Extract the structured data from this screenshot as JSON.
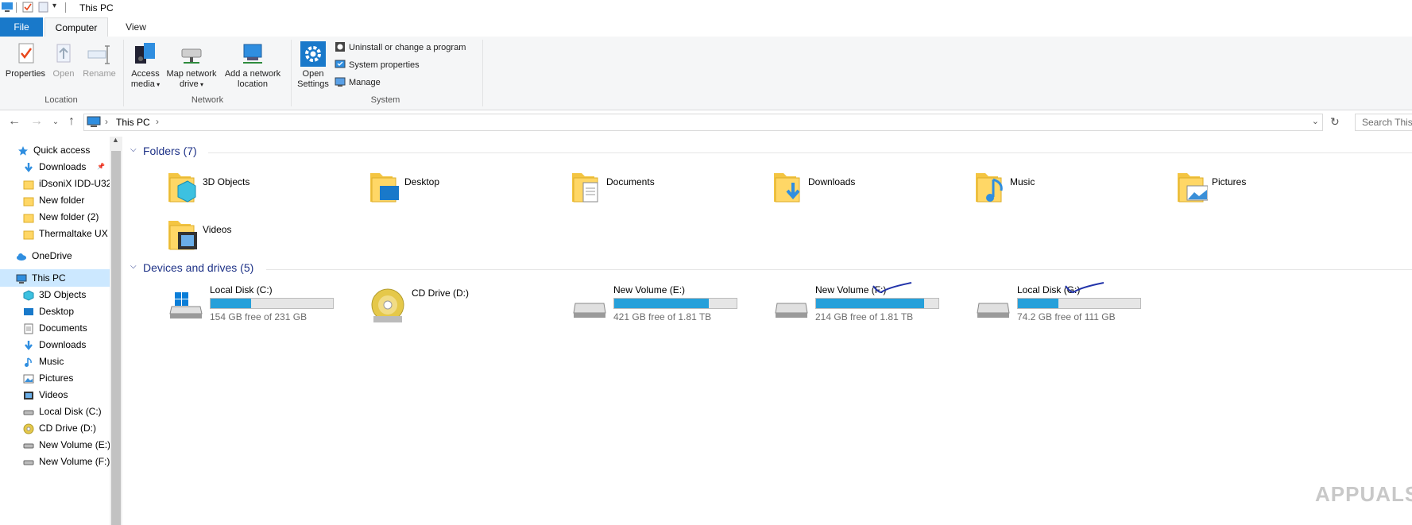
{
  "window": {
    "title": "This PC"
  },
  "ribbon_tabs": {
    "file": "File",
    "computer": "Computer",
    "view": "View"
  },
  "ribbon": {
    "location": {
      "label": "Location",
      "properties": "Properties",
      "open": "Open",
      "rename": "Rename"
    },
    "network": {
      "label": "Network",
      "access_media": "Access media",
      "map_drive_1": "Map network",
      "map_drive_2": "drive",
      "add_location_1": "Add a network",
      "add_location_2": "location"
    },
    "system": {
      "label": "System",
      "open_settings_1": "Open",
      "open_settings_2": "Settings",
      "uninstall": "Uninstall or change a program",
      "sys_props": "System properties",
      "manage": "Manage"
    }
  },
  "address": {
    "crumb": "This PC",
    "search_placeholder": "Search This"
  },
  "nav": [
    {
      "label": "Quick access",
      "icon": "star-icon"
    },
    {
      "label": "Downloads",
      "icon": "download-icon"
    },
    {
      "label": "iDsoniX IDD-U32",
      "icon": "folder-icon"
    },
    {
      "label": "New folder",
      "icon": "folder-icon"
    },
    {
      "label": "New folder (2)",
      "icon": "folder-icon"
    },
    {
      "label": "Thermaltake UX",
      "icon": "folder-icon"
    },
    {
      "label": "OneDrive",
      "icon": "cloud-icon"
    },
    {
      "label": "This PC",
      "icon": "computer-icon"
    },
    {
      "label": "3D Objects",
      "icon": "cube-icon"
    },
    {
      "label": "Desktop",
      "icon": "desktop-icon"
    },
    {
      "label": "Documents",
      "icon": "document-icon"
    },
    {
      "label": "Downloads",
      "icon": "download-icon"
    },
    {
      "label": "Music",
      "icon": "music-icon"
    },
    {
      "label": "Pictures",
      "icon": "pictures-icon"
    },
    {
      "label": "Videos",
      "icon": "video-icon"
    },
    {
      "label": "Local Disk (C:)",
      "icon": "drive-icon"
    },
    {
      "label": "CD Drive (D:)",
      "icon": "cd-icon"
    },
    {
      "label": "New Volume (E:)",
      "icon": "drive-icon"
    },
    {
      "label": "New Volume (F:)",
      "icon": "drive-icon"
    }
  ],
  "folders_section": {
    "title": "Folders (7)"
  },
  "folders": [
    {
      "name": "3D Objects"
    },
    {
      "name": "Desktop"
    },
    {
      "name": "Documents"
    },
    {
      "name": "Downloads"
    },
    {
      "name": "Music"
    },
    {
      "name": "Pictures"
    },
    {
      "name": "Videos"
    }
  ],
  "drives_section": {
    "title": "Devices and drives (5)"
  },
  "drives": [
    {
      "name": "Local Disk (C:)",
      "free": "154 GB free of 231 GB",
      "used_fraction": 0.33
    },
    {
      "name": "CD Drive (D:)",
      "free": "",
      "used_fraction": null
    },
    {
      "name": "New Volume (E:)",
      "free": "421 GB free of 1.81 TB",
      "used_fraction": 0.77
    },
    {
      "name": "New Volume (F:)",
      "free": "214 GB free of 1.81 TB",
      "used_fraction": 0.88
    },
    {
      "name": "Local Disk (G:)",
      "free": "74.2 GB free of 111 GB",
      "used_fraction": 0.33
    }
  ],
  "watermark": "APPUALS",
  "colors": {
    "accent": "#1979ca",
    "bar_fill": "#26a0da",
    "section_head": "#1e3287"
  }
}
